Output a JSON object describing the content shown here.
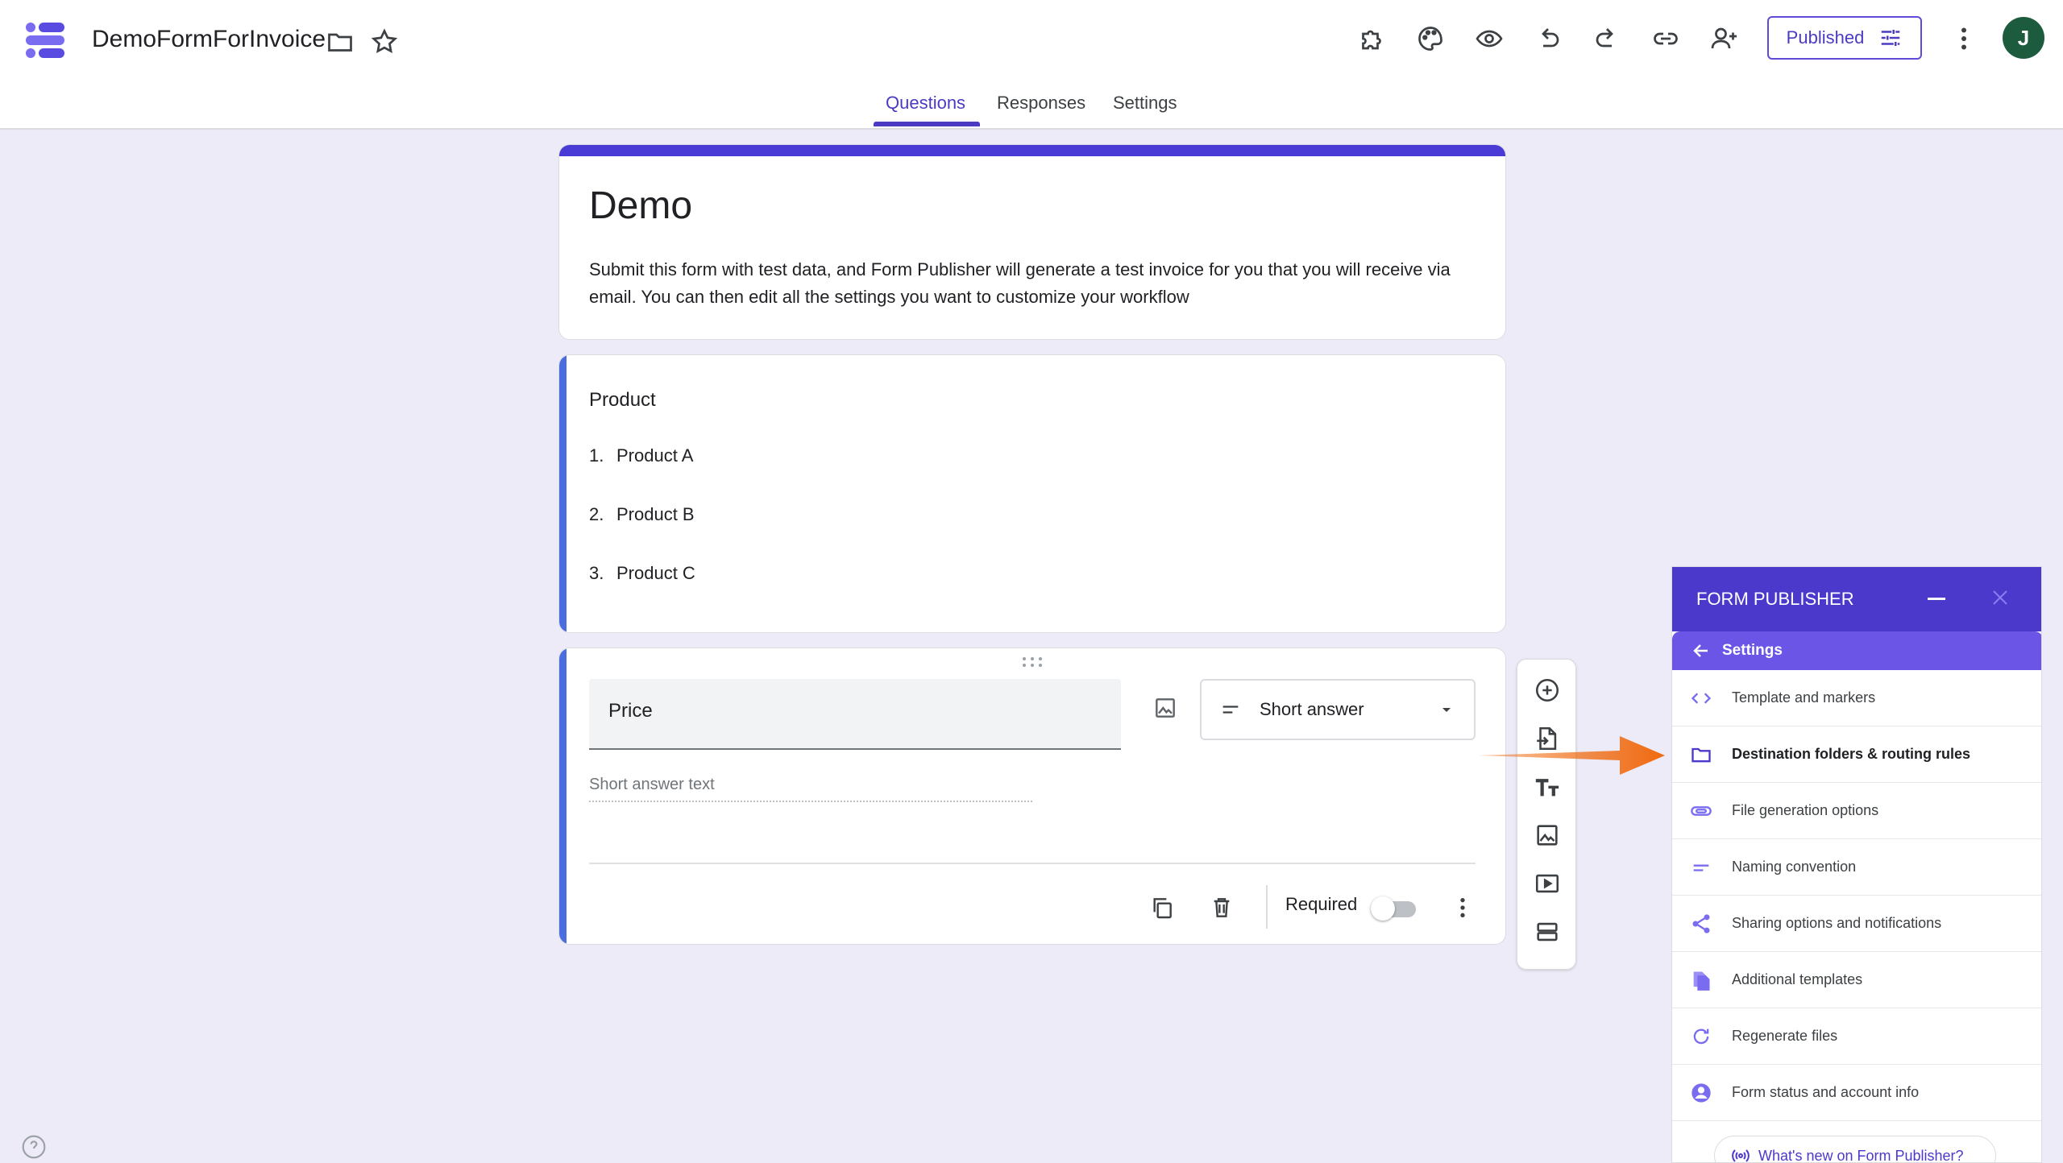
{
  "app": {
    "doc_title": "DemoFormForInvoice"
  },
  "header": {
    "published_label": "Published",
    "avatar_initial": "J",
    "toolbar_icons": [
      "addon-icon",
      "palette-icon",
      "preview-eye-icon",
      "undo-icon",
      "redo-icon",
      "link-icon",
      "add-collaborator-icon",
      "more-vert-icon"
    ]
  },
  "tabs": [
    {
      "label": "Questions",
      "active": true
    },
    {
      "label": "Responses",
      "active": false
    },
    {
      "label": "Settings",
      "active": false
    }
  ],
  "form": {
    "title": "Demo",
    "description": "Submit this form with test data, and Form Publisher will generate a test invoice for you that you will receive via email. You can then edit all the settings you want to customize your workflow"
  },
  "product_question": {
    "title": "Product",
    "items": [
      {
        "num": "1.",
        "label": "Product A"
      },
      {
        "num": "2.",
        "label": "Product B"
      },
      {
        "num": "3.",
        "label": "Product C"
      }
    ]
  },
  "price_question": {
    "title": "Price",
    "type_label": "Short answer",
    "answer_placeholder": "Short answer text",
    "required_label": "Required",
    "required_on": false
  },
  "side_toolbar": [
    "add-question-icon",
    "import-questions-icon",
    "add-title-icon",
    "add-image-icon",
    "add-video-icon",
    "add-section-icon"
  ],
  "panel": {
    "title": "FORM PUBLISHER",
    "back_label": "Settings",
    "items": [
      {
        "label": "Template and markers",
        "icon": "code-icon",
        "active": false
      },
      {
        "label": "Destination folders & routing rules",
        "icon": "folder-icon",
        "active": true
      },
      {
        "label": "File generation options",
        "icon": "attachment-icon",
        "active": false
      },
      {
        "label": "Naming convention",
        "icon": "short-text-icon",
        "active": false
      },
      {
        "label": "Sharing options and notifications",
        "icon": "share-icon",
        "active": false
      },
      {
        "label": "Additional templates",
        "icon": "copy-files-icon",
        "active": false
      },
      {
        "label": "Regenerate files",
        "icon": "refresh-icon",
        "active": false
      },
      {
        "label": "Form status and account info",
        "icon": "account-icon",
        "active": false
      }
    ],
    "whats_new": "What's new on Form Publisher?"
  },
  "colors": {
    "accent": "#4a3bc2",
    "panel_header": "#4b39cc",
    "arrow": "#f06a0f",
    "background": "#ecebf7"
  }
}
